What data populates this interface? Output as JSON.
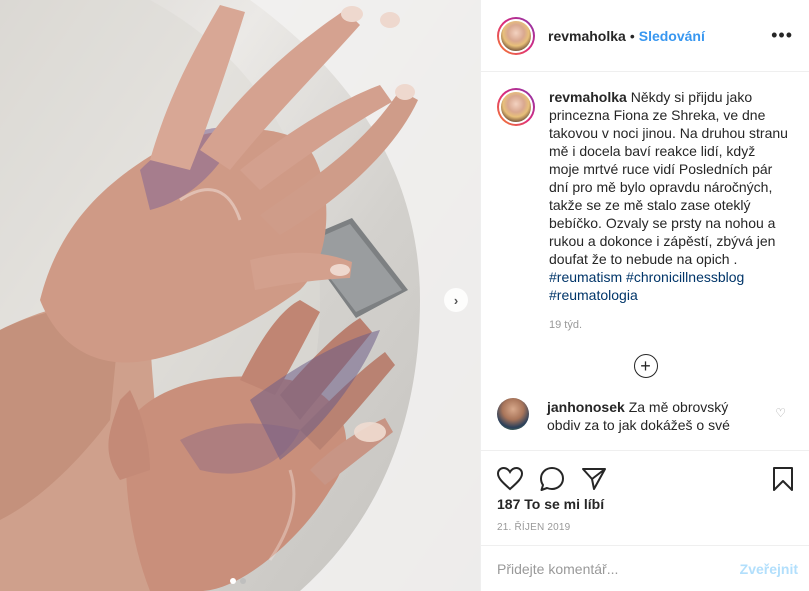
{
  "post": {
    "username": "revmaholka",
    "follow_label": "Sledování",
    "separator": "•",
    "more_label": "•••",
    "caption_text": "Někdy si přijdu jako princezna Fiona ze Shreka, ve dne takovou v noci jinou. Na druhou stranu mě i docela baví reakce lidí, když moje mrtvé ruce vidí ️Posledních pár dní pro mě bylo opravdu náročných, takže se ze mě stalo zase oteklý bebíčko. Ozvaly se prsty na nohou a rukou a dokonce i zápěstí, zbývá jen doufat že to nebude na opich ️️.",
    "hashtags": [
      "#reumatism",
      "#chronicillnessblog",
      "#reumatologia"
    ],
    "time_ago": "19 týd.",
    "load_more_label": "+",
    "likes_label": "187 To se mi líbí",
    "date_label": "21. ŘÍJEN 2019"
  },
  "comments": [
    {
      "username": "janhonosek",
      "text": "Za mě obrovský obdiv za to jak dokážeš o své"
    }
  ],
  "add_comment": {
    "placeholder": "Přidejte komentář...",
    "publish_label": "Zveřejnit"
  },
  "carousel": {
    "next_label": "›",
    "current_index": 1,
    "total": 2
  },
  "colors": {
    "accent": "#3897f0",
    "hashtag": "#003569",
    "publish_disabled": "#b2dffc"
  },
  "icons": [
    "heart-icon",
    "comment-icon",
    "share-icon",
    "bookmark-icon",
    "more-icon",
    "plus-circle-icon",
    "chevron-right-icon"
  ]
}
